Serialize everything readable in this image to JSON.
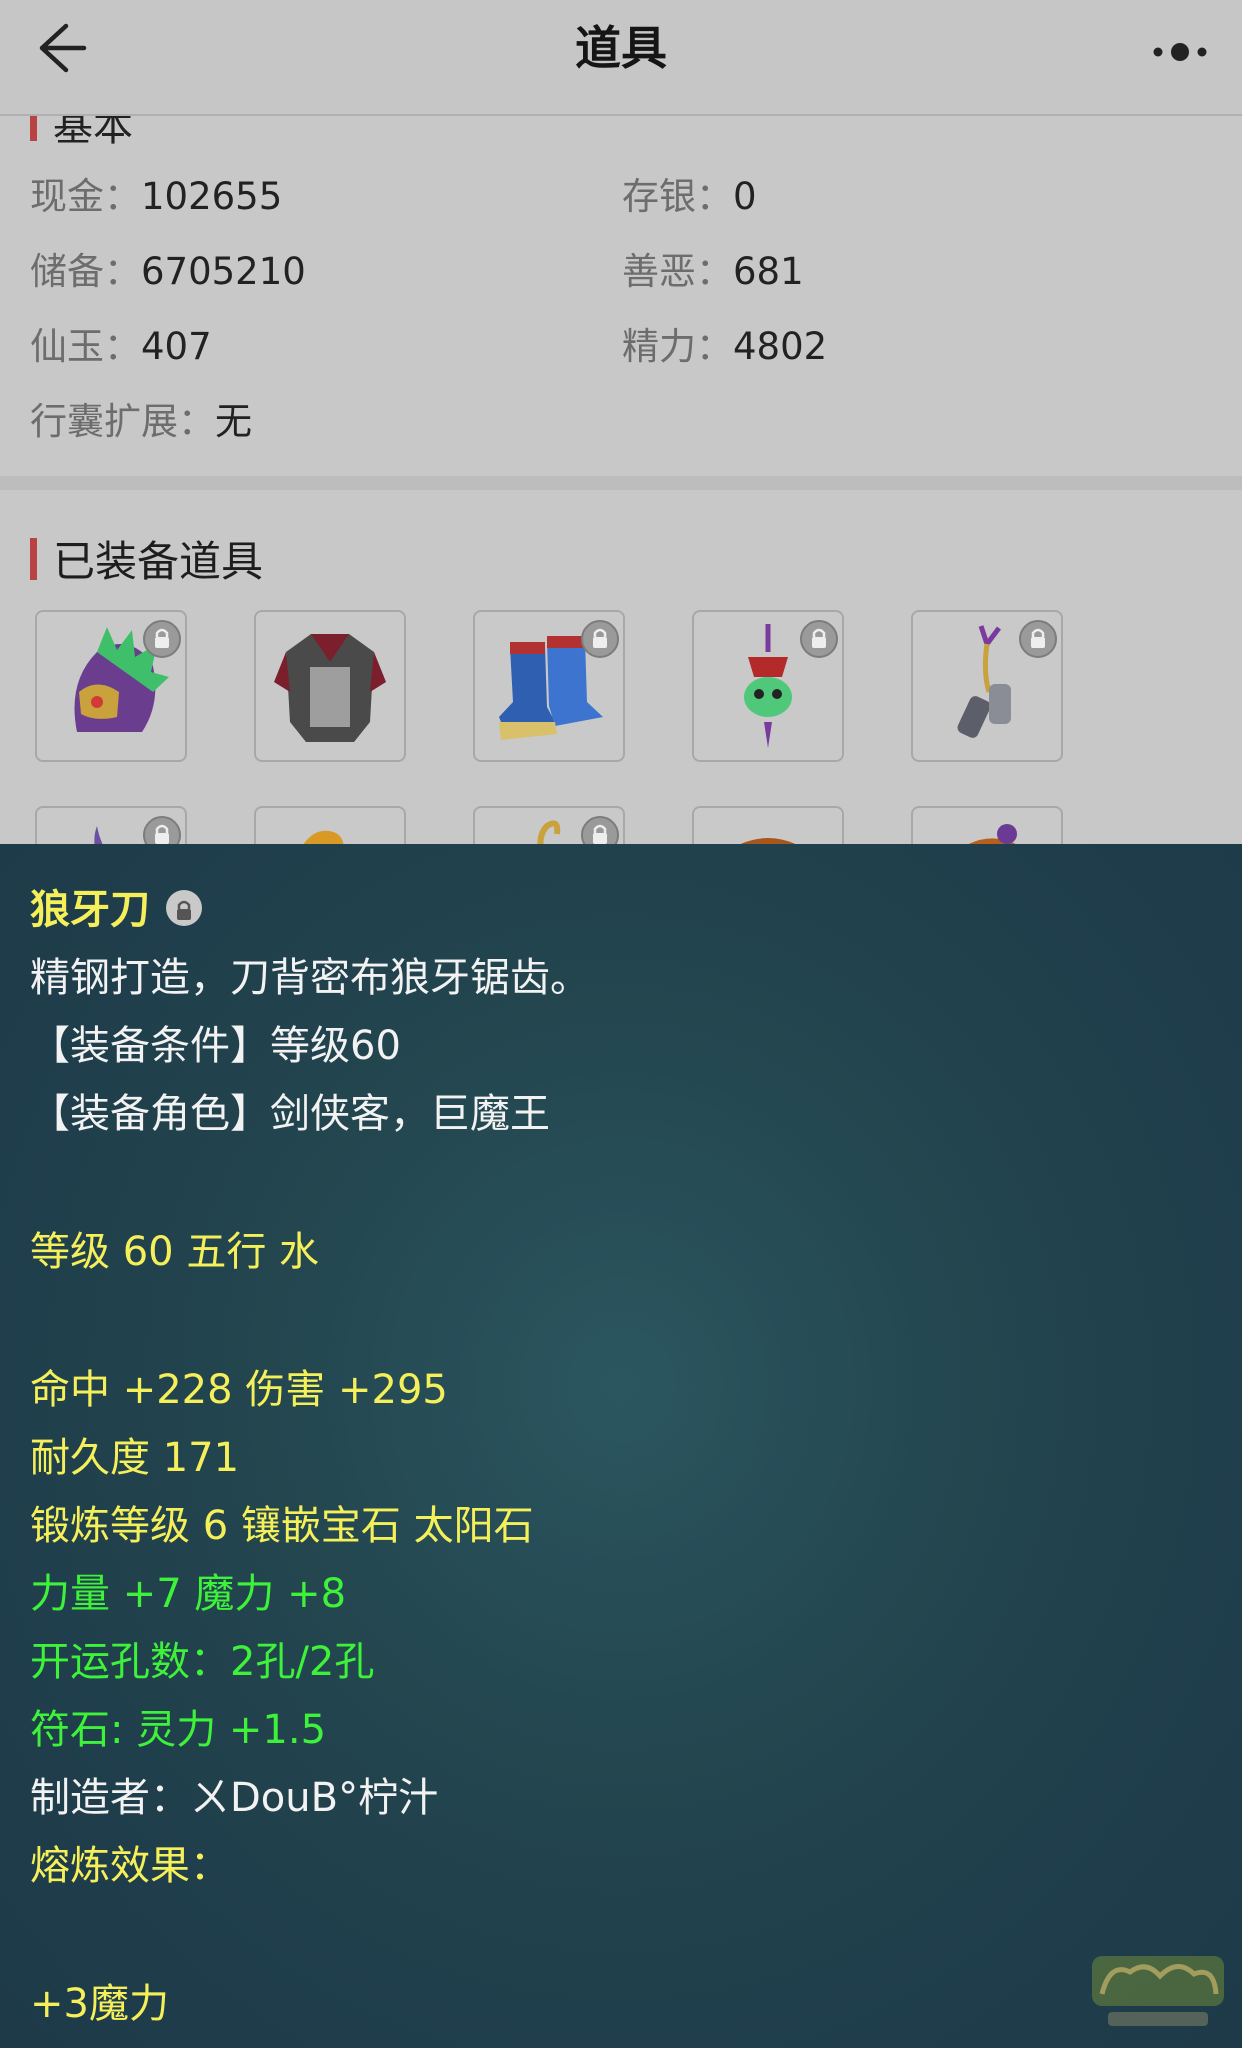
{
  "header": {
    "title": "道具"
  },
  "basic": {
    "section_title": "基本",
    "cash_label": "现金：",
    "cash_value": "102655",
    "deposit_label": "存银：",
    "deposit_value": "0",
    "reserve_label": "储备：",
    "reserve_value": "6705210",
    "karma_label": "善恶：",
    "karma_value": "681",
    "jade_label": "仙玉：",
    "jade_value": "407",
    "energy_label": "精力：",
    "energy_value": "4802",
    "bag_label": "行囊扩展：",
    "bag_value": "无"
  },
  "equipped": {
    "section_title": "已装备道具",
    "row1": [
      {
        "icon": "helmet-icon",
        "locked": true
      },
      {
        "icon": "armor-icon",
        "locked": false
      },
      {
        "icon": "boots-icon",
        "locked": true
      },
      {
        "icon": "necklace-icon",
        "locked": true
      },
      {
        "icon": "belt-icon",
        "locked": true
      }
    ],
    "row2": [
      {
        "icon": "blade-icon",
        "locked": true
      },
      {
        "icon": "leaf-icon",
        "locked": false
      },
      {
        "icon": "serpent-icon",
        "locked": true
      },
      {
        "icon": "hat-icon",
        "locked": false
      },
      {
        "icon": "pouch-icon",
        "locked": false
      }
    ]
  },
  "tooltip": {
    "item_name": "狼牙刀",
    "description": "精钢打造，刀背密布狼牙锯齿。",
    "requirement": "【装备条件】等级60",
    "roles": "【装备角色】剑侠客，巨魔王",
    "level_element": "等级 60 五行 水",
    "hit_damage": "命中 +228 伤害 +295",
    "durability": "耐久度 171",
    "forge": "锻炼等级 6 镶嵌宝石 太阳石",
    "str_magic": "力量 +7 魔力 +8",
    "luck_holes": "开运孔数：2孔/2孔",
    "rune": "符石: 灵力 +1.5",
    "maker": "制造者：ㄨDouB°柠汁",
    "smelt_label": "熔炼效果：",
    "smelt_value": "+3魔力"
  },
  "colors": {
    "accent_bar": "#b94343",
    "tooltip_yellow": "#f5f05a",
    "tooltip_green": "#3ef23a"
  }
}
